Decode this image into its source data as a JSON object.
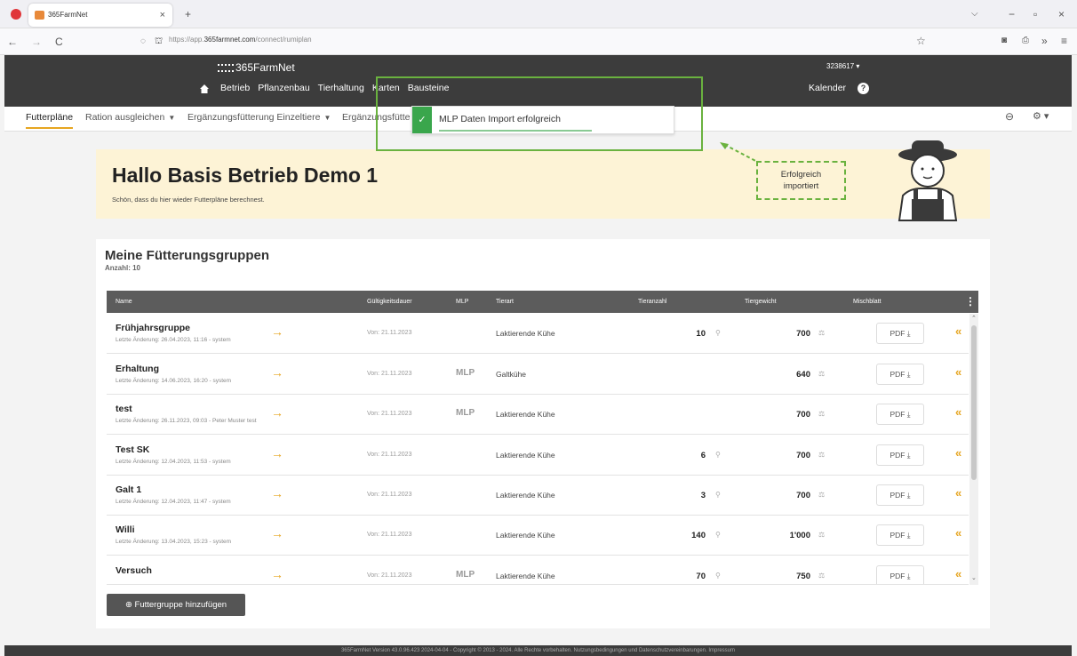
{
  "browser": {
    "tab_title": "365FarmNet",
    "tab_close": "×",
    "new_tab": "+",
    "url_prefix": "https://app.",
    "url_domain": "365farmnet.com",
    "url_path": "/connect/rumiplan",
    "nav_back": "←",
    "nav_forward": "→",
    "nav_reload": "C",
    "window_min": "−",
    "window_max": "▫",
    "window_close": "×",
    "dropdown": "⌵"
  },
  "app": {
    "logo": "365FarmNet",
    "user_id": "3238617 ▾",
    "nav": [
      "Betrieb",
      "Pflanzenbau",
      "Tierhaltung",
      "Karten",
      "Bausteine"
    ],
    "calendar": "Kalender",
    "help": "?",
    "subnav": {
      "active": "Futterpläne",
      "ration": "Ration ausgleichen",
      "einzel": "Ergänzungsfütterung Einzeltiere",
      "ergaenzung": "Ergänzungsfütte"
    }
  },
  "greeting": {
    "title": "Hallo Basis Betrieb Demo 1",
    "subtitle": "Schön, dass du hier wieder Futterpläne berechnest."
  },
  "toast": {
    "text": "MLP Daten Import erfolgreich",
    "check": "✓"
  },
  "callout": {
    "line1": "Erfolgreich",
    "line2": "importiert"
  },
  "groups": {
    "title": "Meine Fütterungsgruppen",
    "count": "Anzahl: 10",
    "columns": {
      "name": "Name",
      "validity": "Gültigkeitsdauer",
      "mlp": "MLP",
      "species": "Tierart",
      "count": "Tieranzahl",
      "weight": "Tiergewicht",
      "sheet": "Mischblatt"
    },
    "rows": [
      {
        "name": "Frühjahrsgruppe",
        "changed": "Letzte Änderung: 26.04.2023, 11:16 - system",
        "valid": "Von: 21.11.2023",
        "mlp": "",
        "species": "Laktierende Kühe",
        "count": "10",
        "weight": "700",
        "pdf": "PDF ⤓"
      },
      {
        "name": "Erhaltung",
        "changed": "Letzte Änderung: 14.06.2023, 16:20 - system",
        "valid": "Von: 21.11.2023",
        "mlp": "MLP",
        "species": "Galtkühe",
        "count": "",
        "weight": "640",
        "pdf": "PDF ⤓"
      },
      {
        "name": "test",
        "changed": "Letzte Änderung: 26.11.2023, 09:03 - Peter Muster test",
        "valid": "Von: 21.11.2023",
        "mlp": "MLP",
        "species": "Laktierende Kühe",
        "count": "",
        "weight": "700",
        "pdf": "PDF ⤓"
      },
      {
        "name": "Test SK",
        "changed": "Letzte Änderung: 12.04.2023, 11:53 - system",
        "valid": "Von: 21.11.2023",
        "mlp": "",
        "species": "Laktierende Kühe",
        "count": "6",
        "weight": "700",
        "pdf": "PDF ⤓"
      },
      {
        "name": "Galt 1",
        "changed": "Letzte Änderung: 12.04.2023, 11:47 - system",
        "valid": "Von: 21.11.2023",
        "mlp": "",
        "species": "Laktierende Kühe",
        "count": "3",
        "weight": "700",
        "pdf": "PDF ⤓"
      },
      {
        "name": "Willi",
        "changed": "Letzte Änderung: 13.04.2023, 15:23 - system",
        "valid": "Von: 21.11.2023",
        "mlp": "",
        "species": "Laktierende Kühe",
        "count": "140",
        "weight": "1'000",
        "pdf": "PDF ⤓"
      },
      {
        "name": "Versuch",
        "changed": "",
        "valid": "Von: 21.11.2023",
        "mlp": "MLP",
        "species": "Laktierende Kühe",
        "count": "70",
        "weight": "750",
        "pdf": "PDF ⤓"
      }
    ],
    "add_button": "⊕ Futtergruppe hinzufügen"
  },
  "icons": {
    "arrow": "→",
    "collapse": "«",
    "count_icon": "⚲",
    "weight_icon": "⚖",
    "more": "⋮",
    "star": "☆",
    "link": "⊖",
    "gear": "⚙ ▾"
  },
  "footer": "365FarmNet Version 43.0.96.423 2024-04-04 - Copyright © 2013 - 2024. Alle Rechte vorbehalten. Nutzungsbedingungen und Datenschutzvereinbarungen. Impressum"
}
